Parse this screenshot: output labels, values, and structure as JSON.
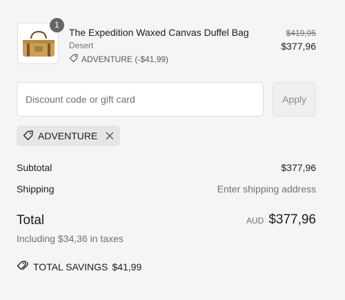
{
  "line_item": {
    "quantity": "1",
    "title": "The Expedition Waxed Canvas Duffel Bag",
    "variant": "Desert",
    "discount": "ADVENTURE (-$41,99)",
    "original_price": "$419,95",
    "price": "$377,96",
    "image_icon": "duffel-bag-image"
  },
  "discount_form": {
    "placeholder": "Discount code or gift card",
    "apply_label": "Apply"
  },
  "applied_code": {
    "code": "ADVENTURE"
  },
  "summary": {
    "subtotal_label": "Subtotal",
    "subtotal_value": "$377,96",
    "shipping_label": "Shipping",
    "shipping_value": "Enter shipping address",
    "total_label": "Total",
    "currency": "AUD",
    "total_value": "$377,96",
    "taxes_note": "Including $34,36 in taxes",
    "savings_label": "TOTAL SAVINGS",
    "savings_value": "$41,99"
  },
  "colors": {
    "background": "#f5f5f5",
    "muted_text": "#707070",
    "badge": "#666666"
  }
}
